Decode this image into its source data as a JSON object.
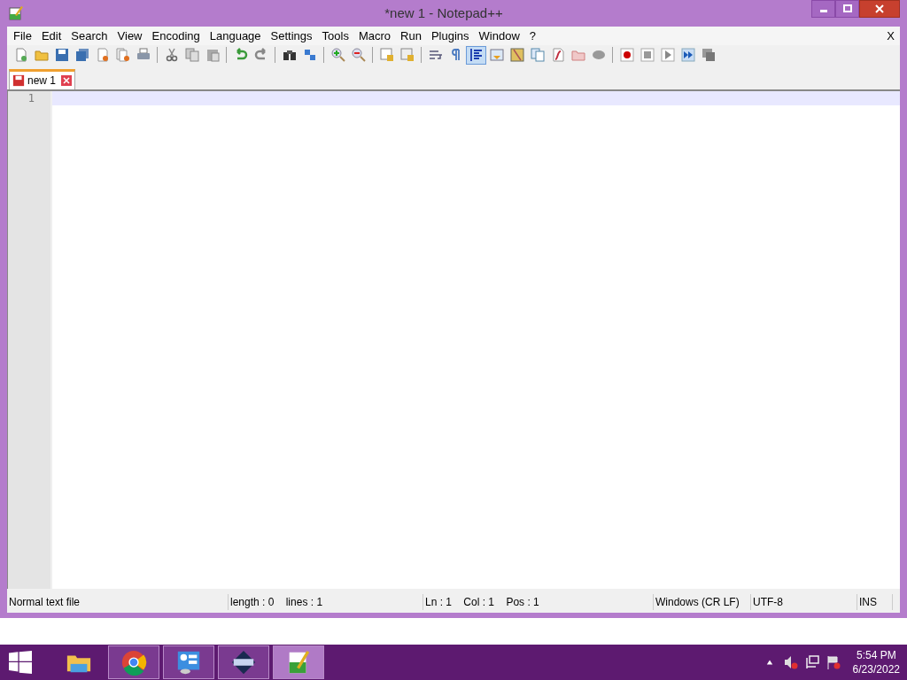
{
  "window": {
    "title": "*new 1 - Notepad++"
  },
  "menu": [
    "File",
    "Edit",
    "Search",
    "View",
    "Encoding",
    "Language",
    "Settings",
    "Tools",
    "Macro",
    "Run",
    "Plugins",
    "Window",
    "?"
  ],
  "menu_close": "X",
  "toolbar": [
    [
      {
        "pressed": false
      },
      {
        "pressed": false
      },
      {
        "pressed": false
      },
      {
        "pressed": false
      },
      {
        "pressed": false
      },
      {
        "pressed": false
      },
      {
        "pressed": false
      }
    ],
    [
      {
        "pressed": false
      },
      {
        "pressed": false
      },
      {
        "pressed": false
      }
    ],
    [
      {
        "pressed": false
      },
      {
        "pressed": false
      }
    ],
    [
      {
        "pressed": false
      },
      {
        "pressed": false
      }
    ],
    [
      {
        "pressed": false
      },
      {
        "pressed": false
      }
    ],
    [
      {
        "pressed": false
      },
      {
        "pressed": false
      }
    ],
    [
      {
        "pressed": false
      },
      {
        "pressed": false
      },
      {
        "pressed": true
      },
      {
        "pressed": false
      },
      {
        "pressed": false
      },
      {
        "pressed": false
      },
      {
        "pressed": false
      },
      {
        "pressed": false
      },
      {
        "pressed": false
      }
    ],
    [
      {
        "pressed": false
      },
      {
        "pressed": false
      },
      {
        "pressed": false
      },
      {
        "pressed": false
      },
      {
        "pressed": false
      }
    ]
  ],
  "tabs": [
    {
      "label": "new 1",
      "selected": true,
      "modified": true
    }
  ],
  "editor": {
    "lines": [
      {
        "number": "1",
        "current": true
      }
    ]
  },
  "status_bar": [
    "Normal text file",
    "length : 0    lines : 1",
    "Ln : 1    Col : 1    Pos : 1",
    "Windows (CR LF)",
    "UTF-8",
    "INS"
  ],
  "taskbar": {
    "apps": [
      {
        "running": false,
        "selected": false
      },
      {
        "running": true,
        "selected": false
      },
      {
        "running": true,
        "selected": false
      },
      {
        "running": true,
        "selected": false
      },
      {
        "running": true,
        "selected": true
      }
    ],
    "tray": {
      "time": "5:54 PM",
      "date": "6/23/2022"
    }
  }
}
